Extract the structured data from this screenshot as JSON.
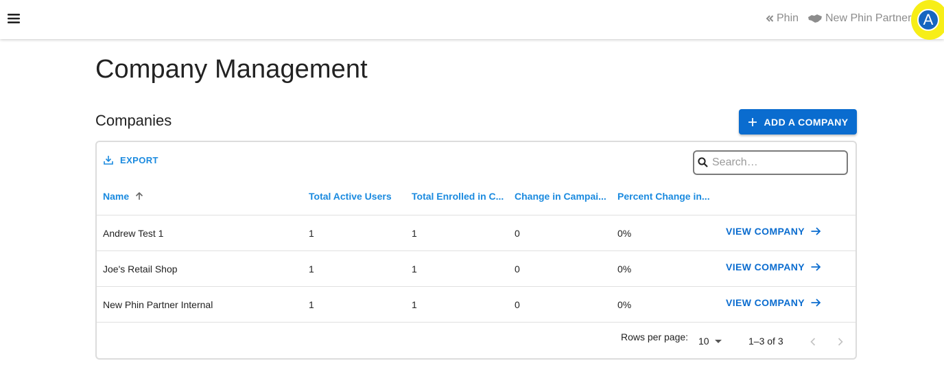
{
  "topbar": {
    "phin_link": "Phin",
    "partner_name": "New Phin Partner",
    "avatar_letter": "A"
  },
  "page": {
    "title": "Company Management",
    "section_title": "Companies",
    "add_button_label": "ADD A COMPANY"
  },
  "grid": {
    "export_label": "EXPORT",
    "search_placeholder": "Search…",
    "search_value": "",
    "columns": [
      {
        "label": "Name",
        "sort": "ascending"
      },
      {
        "label": "Total Active Users"
      },
      {
        "label": "Total Enrolled in C..."
      },
      {
        "label": "Change in Campai..."
      },
      {
        "label": "Percent Change in..."
      }
    ],
    "rows": [
      {
        "name": "Andrew Test 1",
        "active_users": "1",
        "enrolled": "1",
        "change": "0",
        "percent": "0%",
        "action": "VIEW COMPANY"
      },
      {
        "name": "Joe's Retail Shop",
        "active_users": "1",
        "enrolled": "1",
        "change": "0",
        "percent": "0%",
        "action": "VIEW COMPANY"
      },
      {
        "name": "New Phin Partner Internal",
        "active_users": "1",
        "enrolled": "1",
        "change": "0",
        "percent": "0%",
        "action": "VIEW COMPANY"
      }
    ],
    "footer": {
      "rows_per_page_label": "Rows per page:",
      "rows_per_page_value": "10",
      "page_info": "1–3 of 3"
    }
  },
  "colors": {
    "accent": "#0a6ccf",
    "link": "#1a8adf",
    "avatar_bg": "#1565c0",
    "avatar_ring": "#f7ee17",
    "muted": "#8c8c8c"
  },
  "icons": [
    "menu-icon",
    "double-chevron-left-icon",
    "handshake-icon",
    "plus-icon",
    "download-icon",
    "search-icon",
    "arrow-up-icon",
    "arrow-right-icon",
    "caret-down-icon",
    "chevron-left-icon",
    "chevron-right-icon"
  ]
}
